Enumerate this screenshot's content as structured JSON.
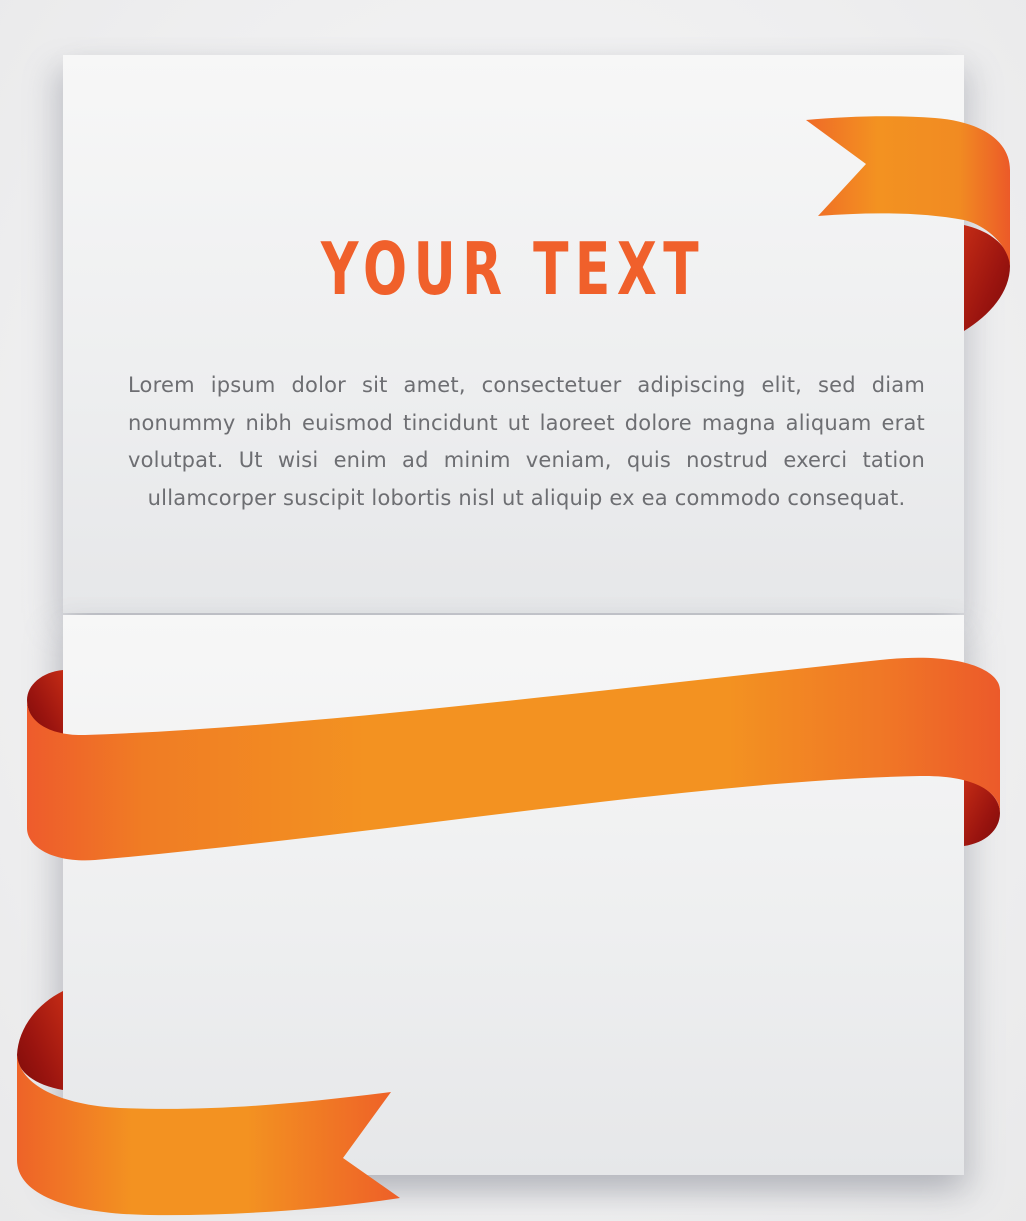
{
  "title": "YOUR TEXT",
  "body": "Lorem ipsum dolor sit amet, consectetuer adipiscing elit, sed diam nonummy nibh euismod tincidunt ut laoreet dolore magna aliquam erat volutpat. Ut wisi enim ad minim veniam, quis nostrud exerci tation ullamcorper suscipit lobortis nisl ut aliquip ex ea commodo consequat.",
  "colors": {
    "accent": "#f0602b",
    "ribbon_light": "#f39221",
    "ribbon_mid": "#f47b20",
    "ribbon_dark": "#ee5a2b",
    "ribbon_fold": "#a71812",
    "text": "#6d6e72",
    "card": "#efeff0"
  }
}
